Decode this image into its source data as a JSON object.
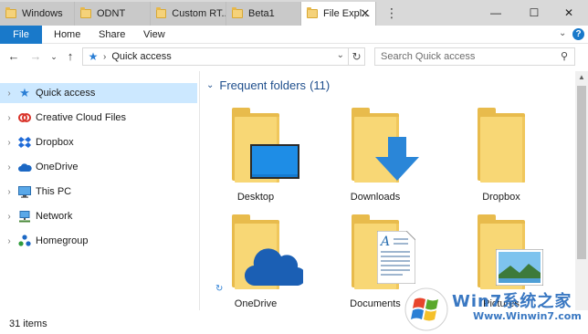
{
  "tabs": [
    {
      "label": "Windows"
    },
    {
      "label": "ODNT"
    },
    {
      "label": "Custom RT..."
    },
    {
      "label": "Beta1"
    },
    {
      "label": "File Expl..."
    }
  ],
  "window_controls": {
    "minimize": "—",
    "maximize": "☐",
    "close": "✕"
  },
  "ribbon": {
    "file": "File",
    "home": "Home",
    "share": "Share",
    "view": "View"
  },
  "address": {
    "location": "Quick access"
  },
  "search": {
    "placeholder": "Search Quick access"
  },
  "nav": [
    {
      "label": "Quick access",
      "icon": "star-icon"
    },
    {
      "label": "Creative Cloud Files",
      "icon": "creative-cloud-icon"
    },
    {
      "label": "Dropbox",
      "icon": "dropbox-icon"
    },
    {
      "label": "OneDrive",
      "icon": "onedrive-icon"
    },
    {
      "label": "This PC",
      "icon": "computer-icon"
    },
    {
      "label": "Network",
      "icon": "network-icon"
    },
    {
      "label": "Homegroup",
      "icon": "homegroup-icon"
    }
  ],
  "content": {
    "group_title": "Frequent folders",
    "group_count": "(11)",
    "folders": [
      {
        "label": "Desktop",
        "overlay": "desktop-icon"
      },
      {
        "label": "Downloads",
        "overlay": "download-arrow-icon"
      },
      {
        "label": "Dropbox",
        "overlay": "none"
      },
      {
        "label": "OneDrive",
        "overlay": "cloud-icon"
      },
      {
        "label": "Documents",
        "overlay": "document-icon"
      },
      {
        "label": "Pictures",
        "overlay": "picture-icon"
      }
    ]
  },
  "status": {
    "item_count": "31 items"
  },
  "watermark": {
    "brand": "Win7系统之家",
    "url": "Www.Winwin7.com"
  },
  "colors": {
    "accent": "#1979ca",
    "selection": "#cce8ff",
    "folder": "#f8d775",
    "heading": "#1e4e8c"
  }
}
